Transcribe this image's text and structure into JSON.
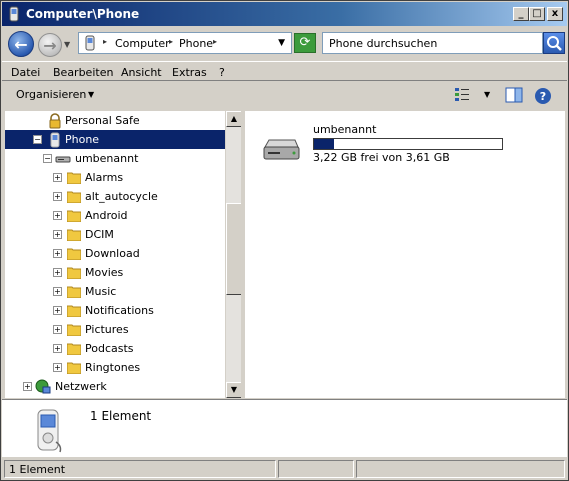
{
  "window": {
    "title": "Computer\\Phone",
    "controls": [
      "_",
      "□",
      "x"
    ]
  },
  "address": {
    "crumbs": [
      "Computer",
      "Phone"
    ],
    "search_placeholder": "Phone durchsuchen"
  },
  "menu": [
    "Datei",
    "Bearbeiten",
    "Ansicht",
    "Extras",
    "?"
  ],
  "toolbar": {
    "organize_label": "Organisieren",
    "icons": [
      "view-options-icon",
      "preview-pane-icon",
      "help-icon"
    ]
  },
  "tree": {
    "items": [
      {
        "label": "Personal Safe",
        "icon": "lock-icon",
        "level": 2
      },
      {
        "label": "Phone",
        "icon": "phone-icon",
        "level": 1,
        "selected": true,
        "expander": "−"
      },
      {
        "label": "umbenannt",
        "icon": "drive-icon",
        "level": 2,
        "expander": "−"
      },
      {
        "label": "Alarms",
        "icon": "folder-icon",
        "level": 3,
        "expander": "+"
      },
      {
        "label": "alt_autocycle",
        "icon": "folder-icon",
        "level": 3,
        "expander": "+"
      },
      {
        "label": "Android",
        "icon": "folder-icon",
        "level": 3,
        "expander": "+"
      },
      {
        "label": "DCIM",
        "icon": "folder-icon",
        "level": 3,
        "expander": "+"
      },
      {
        "label": "Download",
        "icon": "folder-icon",
        "level": 3,
        "expander": "+"
      },
      {
        "label": "Movies",
        "icon": "folder-icon",
        "level": 3,
        "expander": "+"
      },
      {
        "label": "Music",
        "icon": "folder-icon",
        "level": 3,
        "expander": "+"
      },
      {
        "label": "Notifications",
        "icon": "folder-icon",
        "level": 3,
        "expander": "+"
      },
      {
        "label": "Pictures",
        "icon": "folder-icon",
        "level": 3,
        "expander": "+"
      },
      {
        "label": "Podcasts",
        "icon": "folder-icon",
        "level": 3,
        "expander": "+"
      },
      {
        "label": "Ringtones",
        "icon": "folder-icon",
        "level": 3,
        "expander": "+"
      },
      {
        "label": "Netzwerk",
        "icon": "network-icon",
        "level": 0,
        "expander": "+"
      }
    ]
  },
  "content": {
    "drive": {
      "name": "umbenannt",
      "free_text": "3,22 GB frei von 3,61 GB",
      "used_fraction": 0.108
    }
  },
  "details": {
    "count_text": "1 Element"
  },
  "status": {
    "text": "1 Element"
  },
  "colors": {
    "selection": "#0a246a",
    "title_start": "#0a246a",
    "title_end": "#a6caf0"
  }
}
